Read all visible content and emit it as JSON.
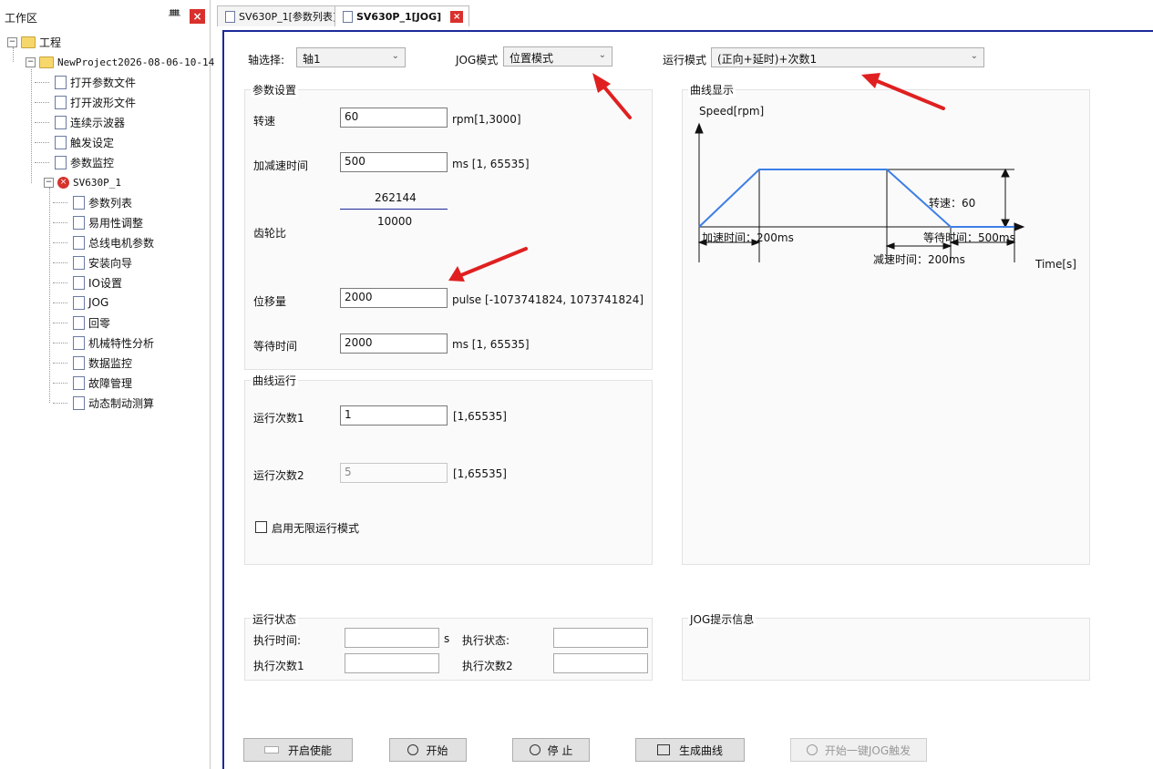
{
  "workspace": {
    "title": "工作区",
    "pin": "ᚙ",
    "close": "×",
    "tree": {
      "root": "工程",
      "project": "NewProject2026-08-06-10-14",
      "project_items": [
        "打开参数文件",
        "打开波形文件",
        "连续示波器",
        "触发设定",
        "参数监控"
      ],
      "device": "SV630P_1",
      "device_items": [
        "参数列表",
        "易用性调整",
        "总线电机参数",
        "安装向导",
        "IO设置",
        "JOG",
        "回零",
        "机械特性分析",
        "数据监控",
        "故障管理",
        "动态制动测算"
      ]
    }
  },
  "tabs": [
    {
      "label": "SV630P_1[参数列表]"
    },
    {
      "label": "SV630P_1[JOG]",
      "close": "×"
    }
  ],
  "top": {
    "axis_label": "轴选择:",
    "axis_value": "轴1",
    "jog_label": "JOG模式",
    "jog_value": "位置模式",
    "run_label": "运行模式",
    "run_value": "(正向+延时)+次数1"
  },
  "params": {
    "title": "参数设置",
    "speed_label": "转速",
    "speed_value": "60",
    "speed_unit": "rpm[1,3000]",
    "accel_label": "加减速时间",
    "accel_value": "500",
    "accel_unit": "ms [1, 65535]",
    "gear_numerator": "262144",
    "gear_denominator": "10000",
    "gear_label": "齿轮比",
    "disp_label": "位移量",
    "disp_value": "2000",
    "disp_unit": "pulse [-1073741824,  1073741824]",
    "wait_label": "等待时间",
    "wait_value": "2000",
    "wait_unit": "ms [1, 65535]"
  },
  "curve_run": {
    "title": "曲线运行",
    "count1_label": "运行次数1",
    "count1_value": "1",
    "count1_range": "[1,65535]",
    "count2_label": "运行次数2",
    "count2_value": "5",
    "count2_range": "[1,65535]",
    "infinite_label": "启用无限运行模式"
  },
  "curve_display": {
    "title": "曲线显示",
    "y_label": "Speed[rpm]",
    "x_label": "Time[s]",
    "speed_text": "转速：60",
    "accel_text": "加速时间：200ms",
    "decel_text": "减速时间：200ms",
    "wait_text": "等待时间：500ms",
    "line_color": "#3d7fe6"
  },
  "status": {
    "title": "运行状态",
    "exec_time_label": "执行时间:",
    "exec_time_unit": "s",
    "exec_state_label": "执行状态:",
    "exec_count1_label": "执行次数1",
    "exec_count2_label": "执行次数2"
  },
  "hint": {
    "title": "JOG提示信息"
  },
  "buttons": {
    "enable": "开启使能",
    "start": "开始",
    "stop": "停 止",
    "gen": "生成曲线",
    "one_key": "开始一键JOG触发"
  },
  "colors": {
    "accent_border": "#1a2a9a",
    "close_red": "#d9302c",
    "annotation_arrow": "#e02020"
  }
}
